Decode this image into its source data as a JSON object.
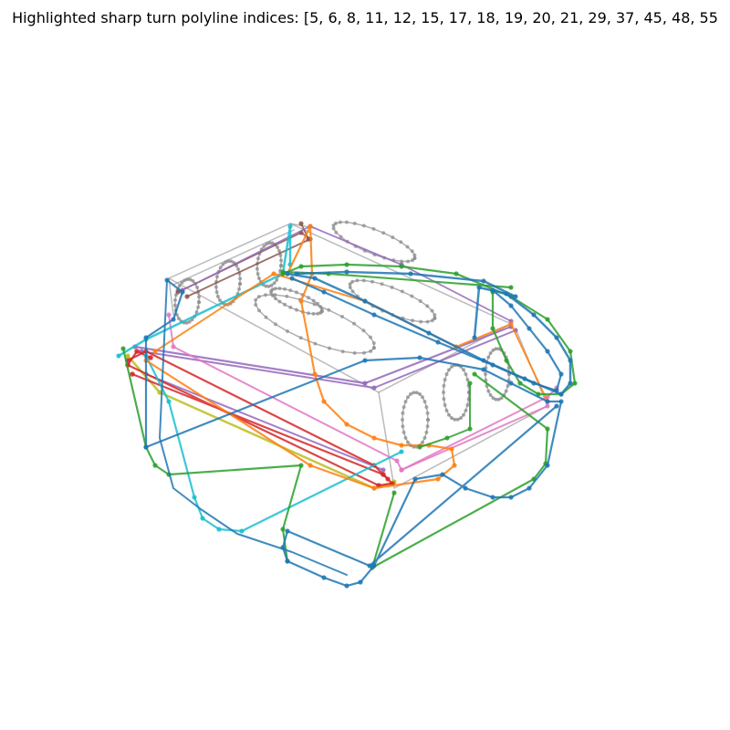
{
  "title": "Highlighted sharp turn polyline indices: [5, 6, 8, 11, 12, 15, 17, 18, 19, 20, 21, 29, 37, 45, 48, 55",
  "colors": {
    "grey": "#8c8c8c",
    "blue": "#1f77b4",
    "orange": "#ff7f0e",
    "green": "#2ca02c",
    "red": "#d62728",
    "purple": "#9467bd",
    "brown": "#8c564b",
    "pink": "#e377c2",
    "olive": "#bcbd22",
    "cyan": "#17becf"
  }
}
